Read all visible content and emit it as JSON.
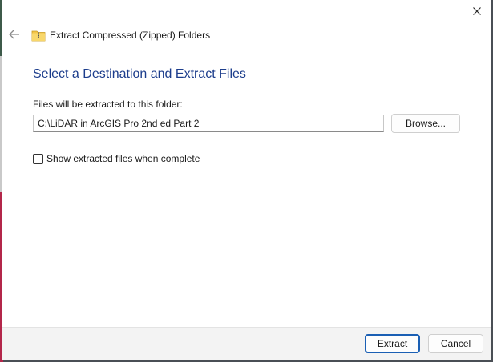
{
  "window": {
    "title": "Extract Compressed (Zipped) Folders"
  },
  "icons": {
    "close": "close-icon",
    "back": "back-arrow-icon",
    "folder": "zip-folder-icon"
  },
  "content": {
    "heading": "Select a Destination and Extract Files",
    "path_label": "Files will be extracted to this folder:",
    "path_value": "C:\\LiDAR in ArcGIS Pro 2nd ed Part 2",
    "browse_label": "Browse...",
    "checkbox_label": "Show extracted files when complete",
    "checkbox_checked": false
  },
  "footer": {
    "extract_label": "Extract",
    "cancel_label": "Cancel"
  },
  "colors": {
    "heading": "#1c3d8c",
    "accent": "#1a5fb4",
    "footer_bg": "#f3f3f3"
  }
}
